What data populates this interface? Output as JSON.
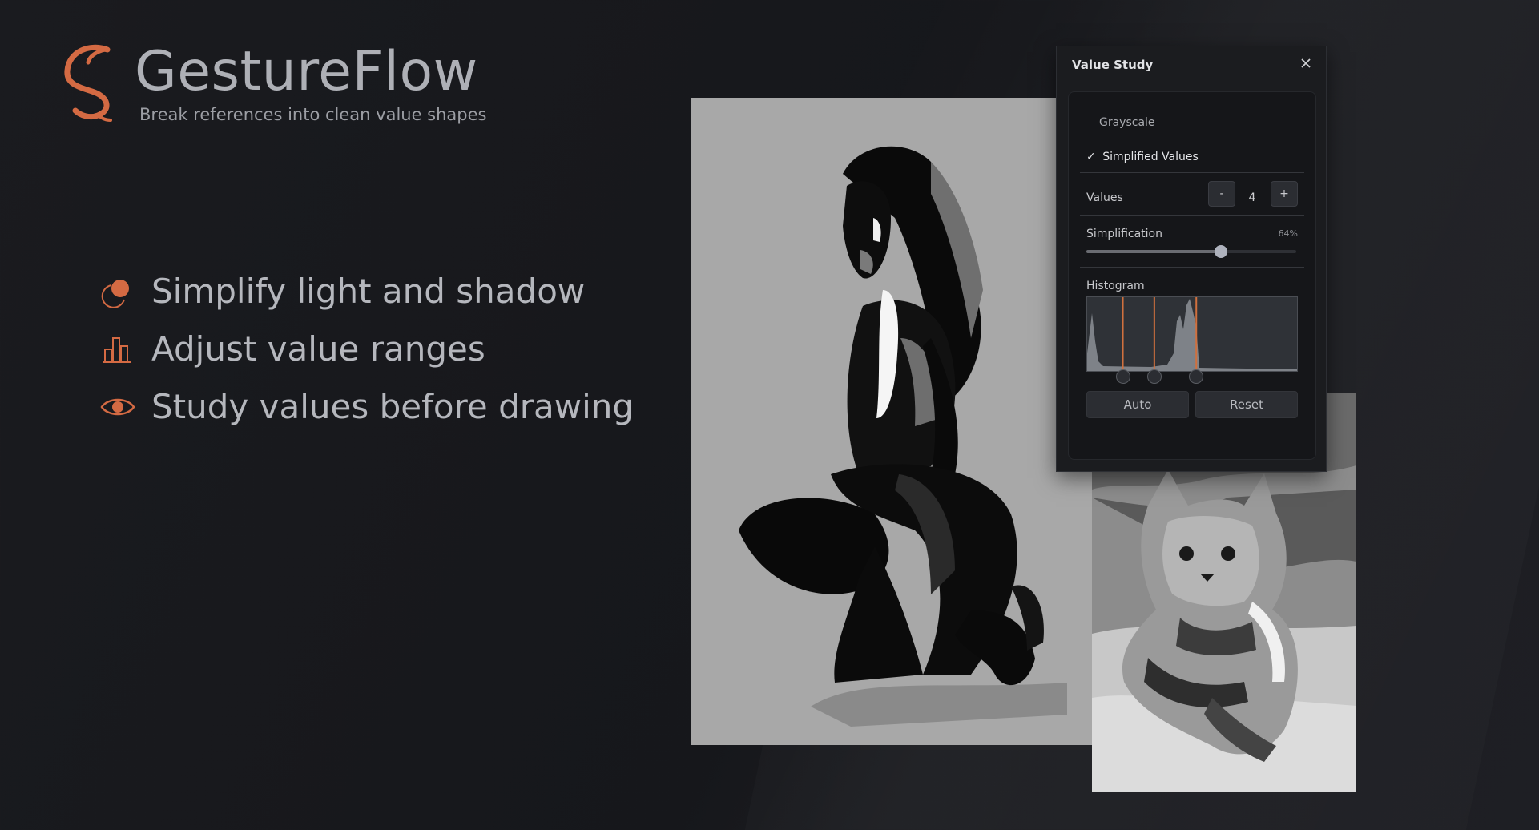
{
  "brand": {
    "title": "GestureFlow",
    "tagline": "Break references into clean value shapes",
    "accent_color": "#d46a43",
    "logo_icon": "swirl-s-logo-icon"
  },
  "features": [
    {
      "icon": "light-shadow-icon",
      "text": "Simplify light and shadow"
    },
    {
      "icon": "bar-chart-icon",
      "text": "Adjust value ranges"
    },
    {
      "icon": "eye-icon",
      "text": "Study values before drawing"
    }
  ],
  "panel": {
    "title": "Value Study",
    "close_icon": "close-icon",
    "modes": [
      {
        "label": "Grayscale",
        "selected": false
      },
      {
        "label": "Simplified Values",
        "selected": true
      }
    ],
    "check_mark": "✓",
    "values": {
      "label": "Values",
      "count": "4",
      "minus": "-",
      "plus": "+"
    },
    "simplification": {
      "label": "Simplification",
      "value_text": "64%",
      "value": 64
    },
    "histogram": {
      "label": "Histogram",
      "handles": [
        0.17,
        0.32,
        0.52
      ],
      "line_color": "#d0703e"
    },
    "buttons": {
      "auto": "Auto",
      "reset": "Reset"
    }
  },
  "references": {
    "main": "figure-kneeling-reference",
    "secondary": "cat-reference"
  }
}
